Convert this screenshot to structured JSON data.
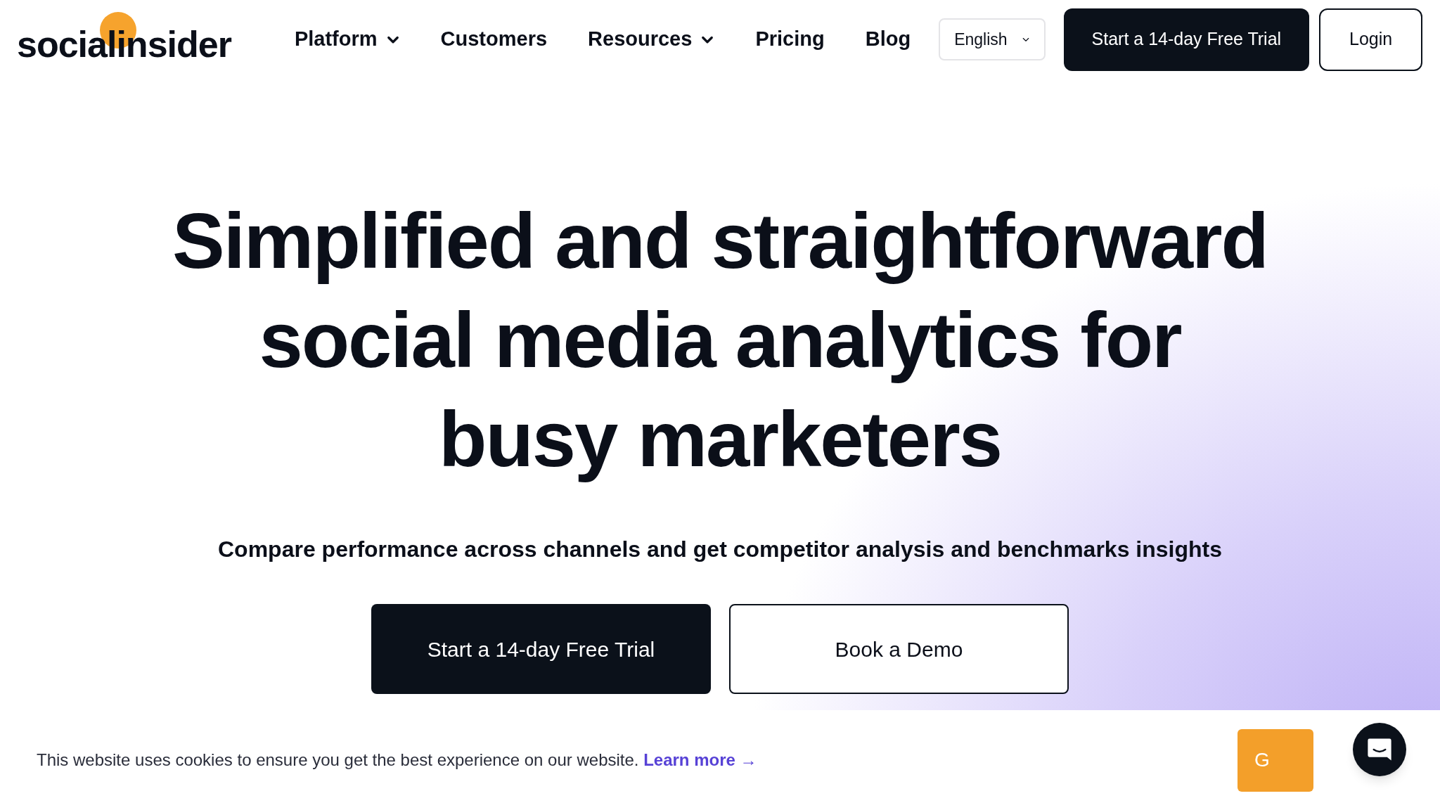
{
  "logo": {
    "text": "socialinsider"
  },
  "nav": {
    "items": [
      {
        "label": "Platform",
        "dropdown": true
      },
      {
        "label": "Customers",
        "dropdown": false
      },
      {
        "label": "Resources",
        "dropdown": true
      },
      {
        "label": "Pricing",
        "dropdown": false
      },
      {
        "label": "Blog",
        "dropdown": false
      }
    ],
    "language": "English",
    "trial_button": "Start a 14-day Free Trial",
    "login_button": "Login"
  },
  "hero": {
    "headline_lines": [
      "Simplified and straightforward",
      "social media analytics for",
      "busy marketers"
    ],
    "subtitle": "Compare performance across channels and get competitor analysis and benchmarks insights",
    "primary_button": "Start a 14-day Free Trial",
    "secondary_button": "Book a Demo"
  },
  "cookie_bar": {
    "text": "This website uses cookies to ensure you get the best experience on our website.",
    "link": "Learn more →",
    "accept_button": "G"
  }
}
